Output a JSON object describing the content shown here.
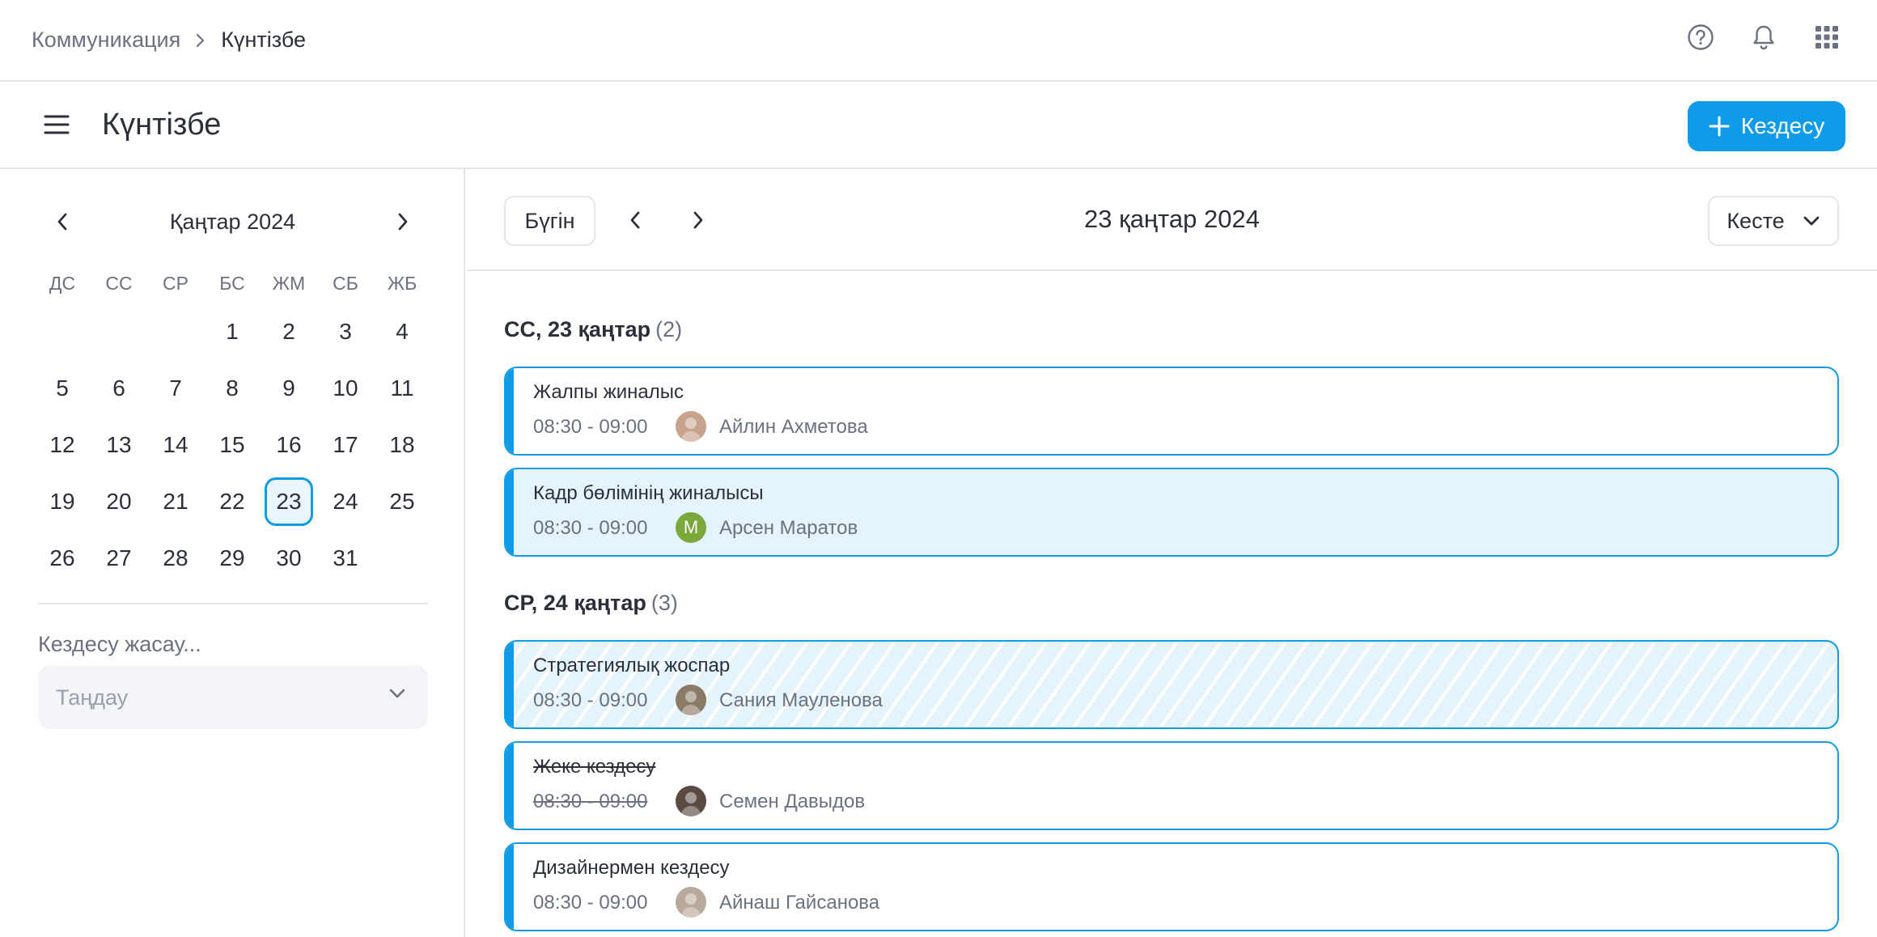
{
  "breadcrumb": {
    "parent": "Коммуникация",
    "current": "Күнтізбе"
  },
  "top_icons": [
    "help-icon",
    "bell-icon",
    "apps-grid-icon"
  ],
  "header": {
    "title": "Күнтізбе",
    "new_button": "Кездесу"
  },
  "sidebar": {
    "month_label": "Қаңтар 2024",
    "weekdays": [
      "ДС",
      "СС",
      "СР",
      "БС",
      "ЖМ",
      "СБ",
      "ЖБ"
    ],
    "days": [
      "",
      "",
      "",
      "1",
      "2",
      "3",
      "4",
      "5",
      "6",
      "7",
      "8",
      "9",
      "10",
      "11",
      "12",
      "13",
      "14",
      "15",
      "16",
      "17",
      "18",
      "19",
      "20",
      "21",
      "22",
      "23",
      "24",
      "25",
      "26",
      "27",
      "28",
      "29",
      "30",
      "31",
      ""
    ],
    "selected_day": "23",
    "create_label": "Кездесу жасау...",
    "select_placeholder": "Таңдау"
  },
  "main": {
    "today_button": "Бүгін",
    "current_date": "23 қаңтар 2024",
    "view_label": "Кесте",
    "groups": [
      {
        "heading": "СС, 23 қаңтар",
        "count": "(2)",
        "events": [
          {
            "title": "Жалпы жиналыс",
            "time": "08:30 - 09:00",
            "person": "Айлин Ахметова",
            "avatar": "photo",
            "avatar_color": "#c7a38d",
            "style": "outline",
            "struck": false
          },
          {
            "title": "Кадр бөлімінің жиналысы",
            "time": "08:30 - 09:00",
            "person": "Арсен Маратов",
            "avatar": "initial",
            "avatar_initial": "М",
            "avatar_color": "#7aa83a",
            "style": "filled",
            "struck": false
          }
        ]
      },
      {
        "heading": "СР, 24 қаңтар",
        "count": "(3)",
        "events": [
          {
            "title": "Стратегиялық жоспар",
            "time": "08:30 - 09:00",
            "person": "Сания Мауленова",
            "avatar": "photo",
            "avatar_color": "#8a7a66",
            "style": "striped",
            "struck": false
          },
          {
            "title": "Жеке кездесу",
            "time": "08:30 - 09:00",
            "person": "Семен Давыдов",
            "avatar": "photo",
            "avatar_color": "#5a4a42",
            "style": "outline",
            "struck": true
          },
          {
            "title": "Дизайнермен кездесу",
            "time": "08:30 - 09:00",
            "person": "Айнаш Гайсанова",
            "avatar": "photo",
            "avatar_color": "#b8a99a",
            "style": "outline",
            "struck": false
          }
        ]
      }
    ]
  },
  "colors": {
    "accent": "#0f9be8",
    "event_fill": "#e4f3fc",
    "border": "#e3e6ea",
    "muted_text": "#6b7180"
  }
}
